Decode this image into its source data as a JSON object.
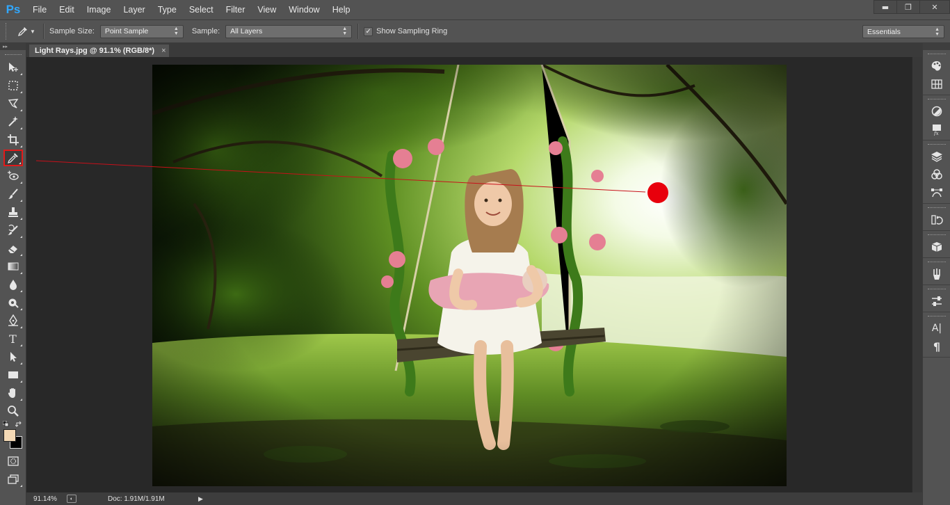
{
  "app": {
    "logo": "Ps"
  },
  "menu": [
    "File",
    "Edit",
    "Image",
    "Layer",
    "Type",
    "Select",
    "Filter",
    "View",
    "Window",
    "Help"
  ],
  "window_controls": {
    "minimize": "▬",
    "restore": "❐",
    "close": "✕"
  },
  "options": {
    "sample_size_label": "Sample Size:",
    "sample_size_value": "Point Sample",
    "sample_label": "Sample:",
    "sample_value": "All Layers",
    "show_ring_checked": "✓",
    "show_ring_label": "Show Sampling Ring",
    "workspace": "Essentials"
  },
  "document": {
    "tab_title": "Light Rays.jpg @ 91.1% (RGB/8*)",
    "tab_close": "×"
  },
  "status": {
    "zoom": "91.14%",
    "doc_size": "Doc: 1.91M/1.91M"
  },
  "tools": [
    {
      "name": "move-tool-icon"
    },
    {
      "name": "marquee-tool-icon"
    },
    {
      "name": "lasso-tool-icon"
    },
    {
      "name": "magic-wand-tool-icon"
    },
    {
      "name": "crop-tool-icon"
    },
    {
      "name": "eyedropper-tool-icon",
      "active": true
    },
    {
      "name": "spot-healing-tool-icon"
    },
    {
      "name": "brush-tool-icon"
    },
    {
      "name": "clone-stamp-tool-icon"
    },
    {
      "name": "history-brush-tool-icon"
    },
    {
      "name": "eraser-tool-icon"
    },
    {
      "name": "gradient-tool-icon"
    },
    {
      "name": "blur-tool-icon"
    },
    {
      "name": "dodge-tool-icon"
    },
    {
      "name": "pen-tool-icon"
    },
    {
      "name": "type-tool-icon"
    },
    {
      "name": "path-selection-tool-icon"
    },
    {
      "name": "rectangle-tool-icon"
    },
    {
      "name": "hand-tool-icon"
    },
    {
      "name": "zoom-tool-icon"
    }
  ],
  "type_tool_glyph": "T",
  "colors": {
    "foreground": "#f4d9b5",
    "background": "#000000",
    "annotation": "#e8000c",
    "accent": "#31a8ff"
  },
  "right_panel_icons": [
    "color-panel-icon",
    "swatches-panel-icon",
    "adjustments-panel-icon",
    "styles-panel-icon",
    "layers-panel-icon",
    "channels-panel-icon",
    "paths-panel-icon",
    "history-panel-icon",
    "3d-panel-icon",
    "brush-presets-icon",
    "tool-presets-icon",
    "character-panel-icon",
    "paragraph-panel-icon"
  ],
  "character_glyph": "A|",
  "paragraph_glyph": "¶"
}
